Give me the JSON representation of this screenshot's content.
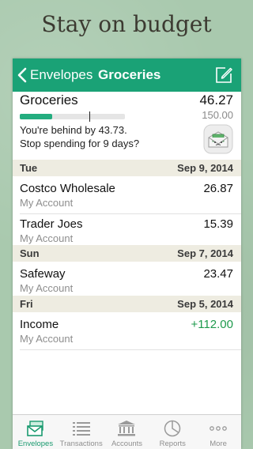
{
  "promo": {
    "headline": "Stay on budget"
  },
  "navbar": {
    "back_label": "Envelopes",
    "title": "Groceries"
  },
  "envelope": {
    "name": "Groceries",
    "amount": "46.27",
    "budget": "150.00",
    "progress_fraction": 0.31,
    "message_line1": "You're behind by 43.73.",
    "message_line2": "Stop spending for 9 days?"
  },
  "sections": [
    {
      "day": "Tue",
      "date": "Sep 9, 2014",
      "transactions": [
        {
          "payee": "Costco Wholesale",
          "account": "My Account",
          "amount": "26.87"
        },
        {
          "payee": "Trader Joes",
          "account": "My Account",
          "amount": "15.39"
        }
      ]
    },
    {
      "day": "Sun",
      "date": "Sep 7, 2014",
      "transactions": [
        {
          "payee": "Safeway",
          "account": "My Account",
          "amount": "23.47"
        }
      ]
    },
    {
      "day": "Fri",
      "date": "Sep 5, 2014",
      "transactions": [
        {
          "payee": "Income",
          "account": "My Account",
          "amount": "+112.00"
        }
      ]
    }
  ],
  "tabbar": {
    "items": [
      {
        "label": "Envelopes",
        "icon": "envelopes-icon",
        "active": true
      },
      {
        "label": "Transactions",
        "icon": "list-icon",
        "active": false
      },
      {
        "label": "Accounts",
        "icon": "bank-icon",
        "active": false
      },
      {
        "label": "Reports",
        "icon": "pie-chart-icon",
        "active": false
      },
      {
        "label": "More",
        "icon": "more-dots-icon",
        "active": false
      }
    ]
  },
  "colors": {
    "accent": "#1aa276",
    "positive": "#1e9a4c",
    "section_bg": "#eeece1"
  }
}
